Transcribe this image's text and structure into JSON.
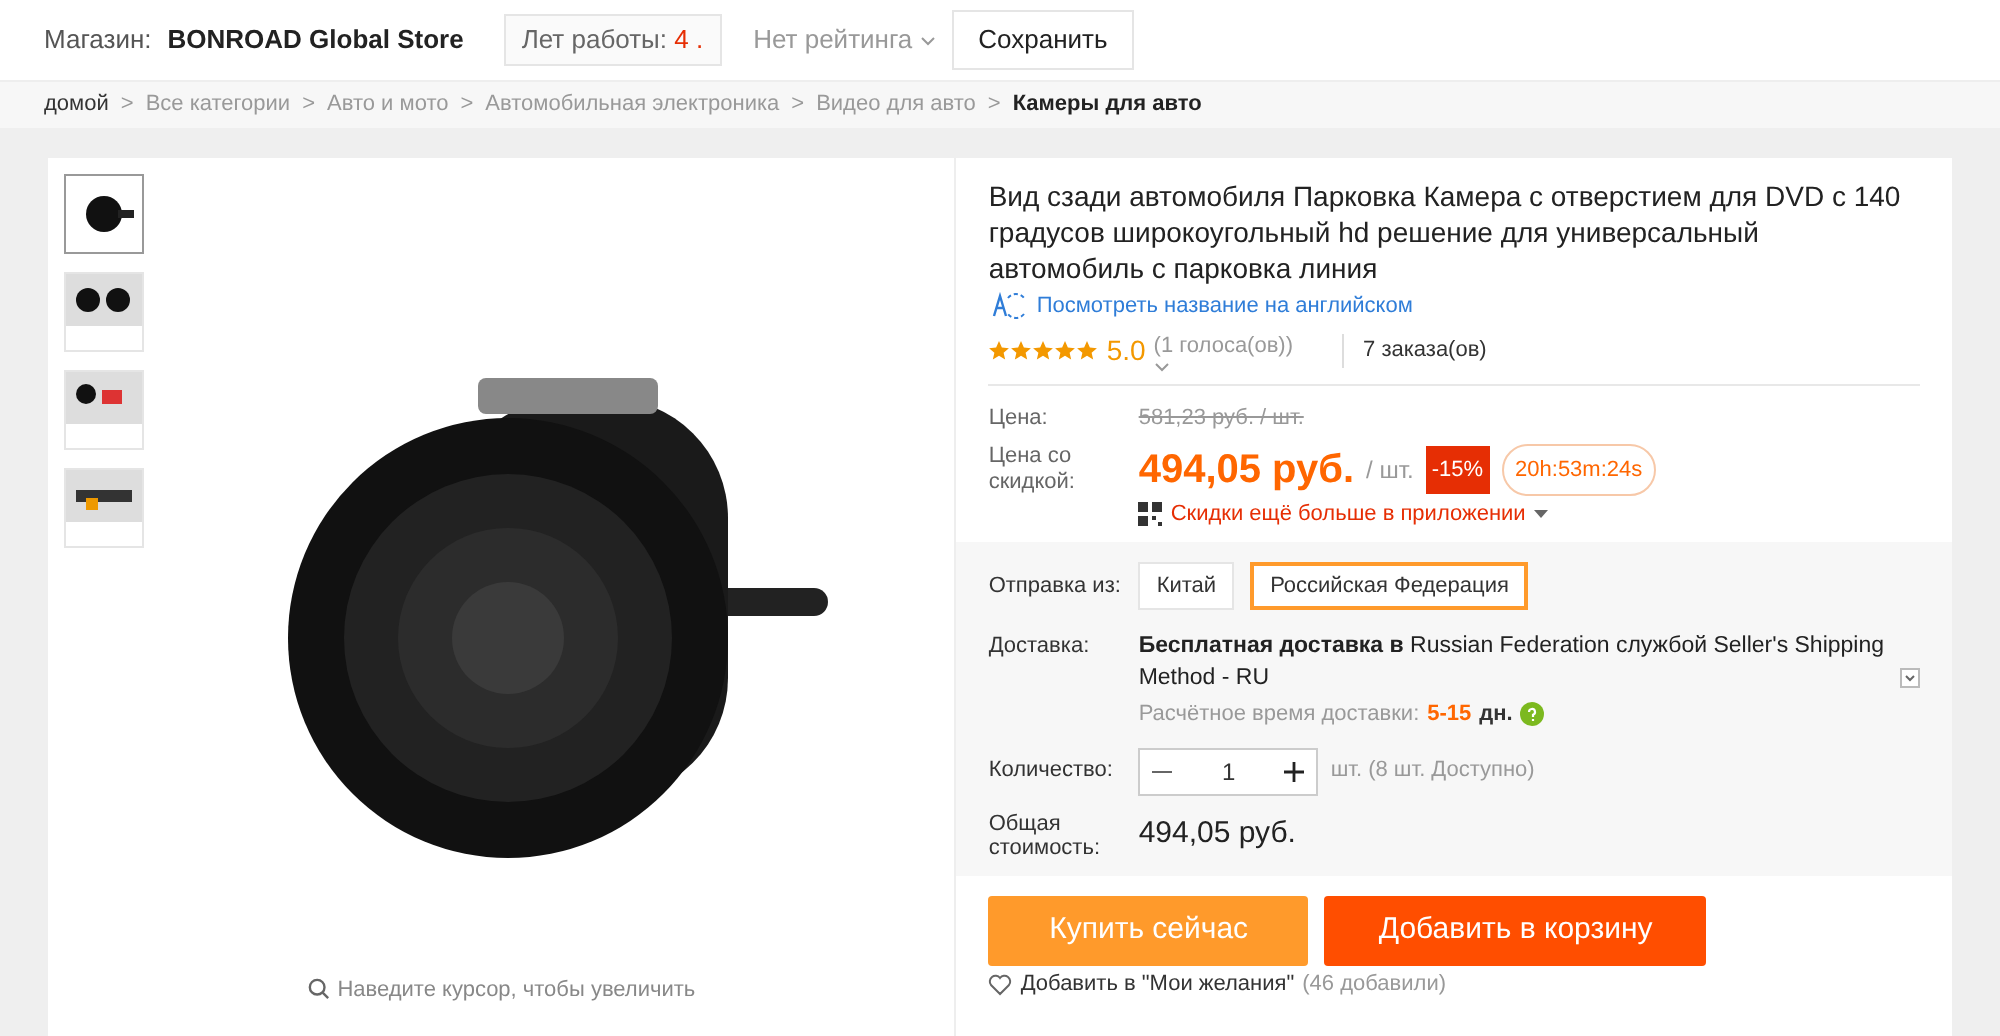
{
  "store_bar": {
    "store_label": "Магазин:",
    "store_name": "BONROAD Global Store",
    "years_label": "Лет работы:",
    "years_value": "4 .",
    "rating": "Нет рейтинга",
    "save_button": "Сохранить"
  },
  "breadcrumb": {
    "separator": ">",
    "items": [
      {
        "label": "домой",
        "current": false
      },
      {
        "label": "Все категории",
        "current": false
      },
      {
        "label": "Авто и мото",
        "current": false
      },
      {
        "label": "Автомобильная электроника",
        "current": false
      },
      {
        "label": "Видео для авто",
        "current": false
      },
      {
        "label": "Камеры для авто",
        "current": true
      }
    ]
  },
  "gallery": {
    "thumbnails": [
      {
        "selected": true
      },
      {
        "selected": false
      },
      {
        "selected": false
      },
      {
        "selected": false
      }
    ],
    "zoom_hint": "Наведите курсор, чтобы увеличить"
  },
  "product": {
    "title": "Вид сзади автомобиля Парковка Камера с отверстием для DVD с 140 градусов широкоугольный hd решение для универсальный автомобиль с парковка линия",
    "translate_link": "Посмотреть название на английском",
    "stars": 5,
    "rating": "5.0",
    "votes": "(1 голоса(ов))",
    "orders": "7 заказа(ов)",
    "price_label": "Цена:",
    "old_price": "581,23 руб. / шт.",
    "discount_label": "Цена со скидкой:",
    "price": "494,05 руб.",
    "unit": "/ шт.",
    "discount": "-15%",
    "timer": "20h:53m:24s",
    "app_promo": "Скидки ещё больше в приложении",
    "ship_from_label": "Отправка из:",
    "ship_from": [
      {
        "label": "Китай",
        "selected": false
      },
      {
        "label": "Российская Федерация",
        "selected": true
      }
    ],
    "delivery_label": "Доставка:",
    "delivery": "**Бесплатная доставка в** Russian Federation службой Seller's Shipping Method - RU",
    "delivery_time_label": "Расчётное время доставки:",
    "delivery_time": "5-15",
    "delivery_unit": "дн.",
    "quantity_label": "Количество:",
    "quantity": "1",
    "availability": "шт. (8 шт. Доступно)",
    "total_label": "Общая стоимость:",
    "total": "494,05 руб.",
    "buy_now": "Купить сейчас",
    "add_to_cart": "Добавить в корзину",
    "wishlist": "Добавить в \"Мои желания\"",
    "wishlist_count": "(46 добавили)"
  }
}
